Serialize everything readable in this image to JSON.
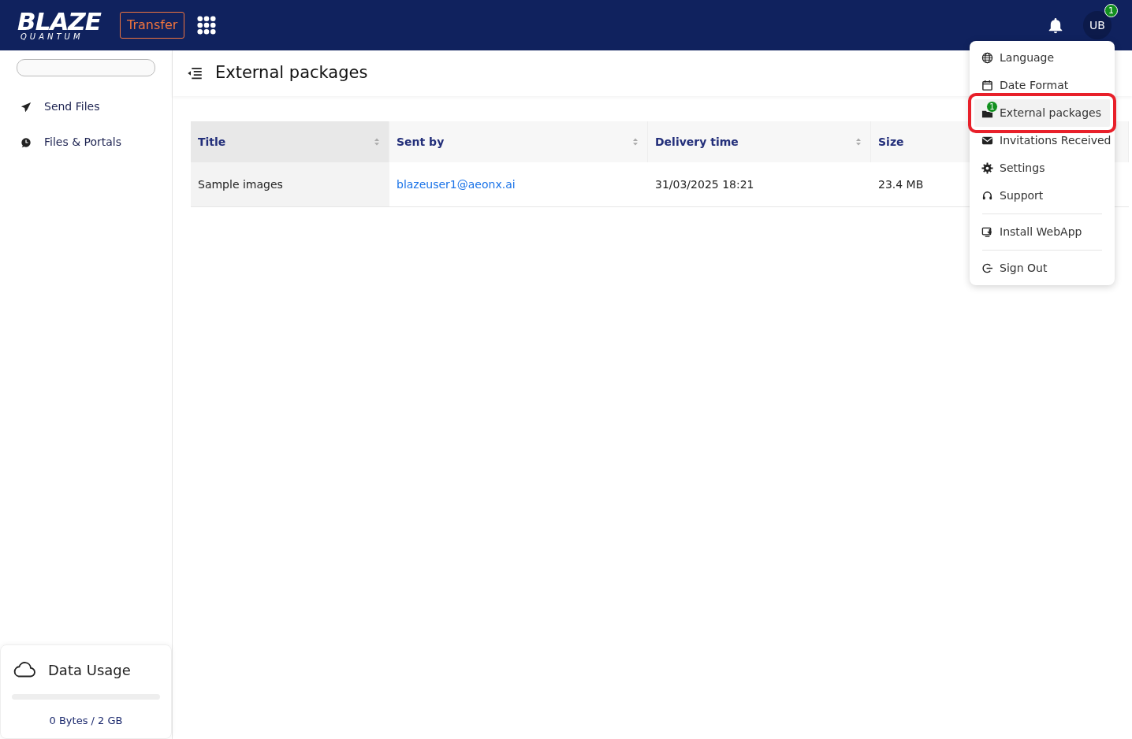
{
  "navbar": {
    "logo_main": "BLAZE",
    "logo_sub": "QUANTUM",
    "app_button": "Transfer",
    "avatar": "UB",
    "avatar_badge": "1"
  },
  "sidebar": {
    "items": [
      {
        "label": "Send Files",
        "selected": false
      },
      {
        "label": "Files & Portals",
        "selected": false
      }
    ],
    "data_usage": {
      "title": "Data Usage",
      "level": 0,
      "reading": "0 Bytes / 2 GB"
    }
  },
  "page": {
    "title": "External packages"
  },
  "table": {
    "columns": [
      {
        "label": "Title",
        "sorted": true
      },
      {
        "label": "Sent by",
        "sorted": false
      },
      {
        "label": "Delivery time",
        "sorted": false
      },
      {
        "label": "Size",
        "sorted": false
      }
    ],
    "rows": [
      [
        "Sample images",
        "blazeuser1@aeonx.ai",
        "31/03/2025 18:21",
        "23.4 MB"
      ]
    ]
  },
  "user_menu": {
    "items": [
      {
        "kind": "item",
        "label": "Language",
        "selected": false,
        "highlighted": false
      },
      {
        "kind": "item",
        "label": "Date Format",
        "selected": false,
        "highlighted": false
      },
      {
        "kind": "item",
        "label": "External packages",
        "badge": "1",
        "selected": true,
        "highlighted": true
      },
      {
        "kind": "item",
        "label": "Invitations Received",
        "selected": false,
        "highlighted": false
      },
      {
        "kind": "item",
        "label": "Settings",
        "selected": false,
        "highlighted": false
      },
      {
        "kind": "item",
        "label": "Support",
        "selected": false,
        "highlighted": false
      },
      {
        "kind": "divider"
      },
      {
        "kind": "item",
        "label": "Install WebApp",
        "selected": false,
        "highlighted": false
      },
      {
        "kind": "divider"
      },
      {
        "kind": "item",
        "label": "Sign Out",
        "selected": false,
        "highlighted": false
      }
    ]
  }
}
